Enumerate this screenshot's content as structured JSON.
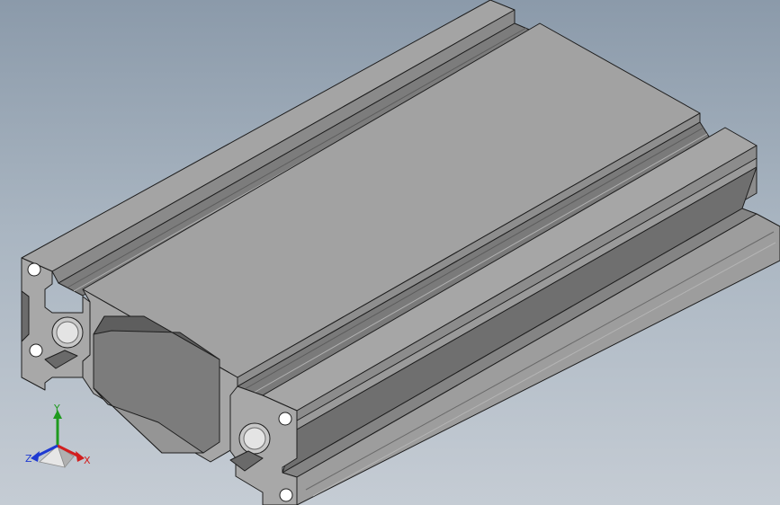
{
  "viewport": {
    "name": "graphics-area",
    "background_top": "#8b9aaa",
    "background_bottom": "#c5ccd4"
  },
  "model": {
    "description_icon": "aluminum-extrusion-profile",
    "face_color": "#9a9a9a",
    "edge_color": "#1e1e1e"
  },
  "triad": {
    "x_label": "X",
    "y_label": "Y",
    "z_label": "Z",
    "x_color": "#d21e1e",
    "y_color": "#1e9a1e",
    "z_color": "#1e3ad2"
  }
}
